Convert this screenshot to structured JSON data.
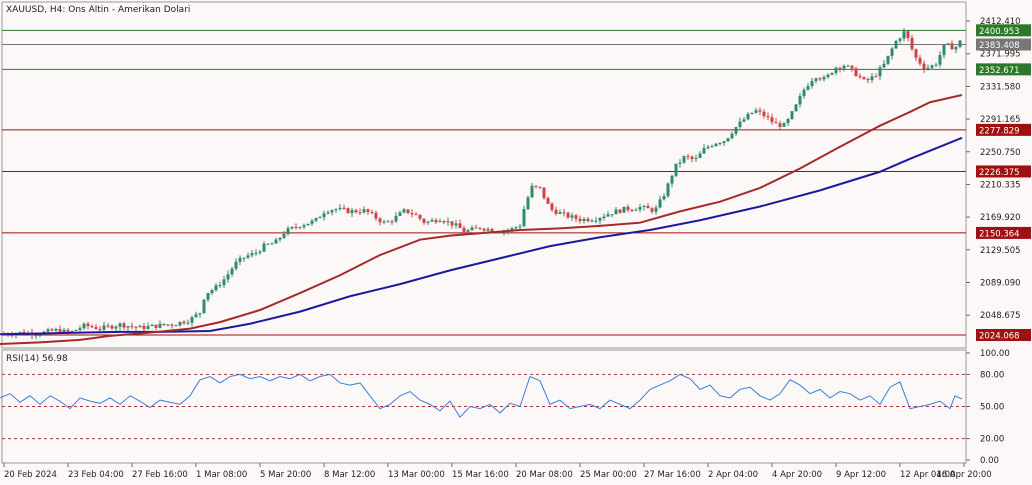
{
  "window": {
    "symbol_title": "XAUUSD, H4:  Ons Altin - Amerikan Dolari"
  },
  "colors": {
    "background": "#fdf8f8",
    "candle_up": "#2e8b6e",
    "candle_down": "#cc4444",
    "ma_fast": "#a52a2a",
    "ma_slow": "#1a1aa0",
    "rsi_line": "#3a7fd4",
    "level_green": "#2a7a2a",
    "level_red": "#a01010"
  },
  "chart_data": [
    {
      "type": "candlestick",
      "title": "XAUUSD, H4:  Ons Altin - Amerikan Dolari",
      "ylim": [
        2008,
        2436
      ],
      "y_ticks": [
        "2412.410",
        "2371.995",
        "2331.580",
        "2291.165",
        "2250.750",
        "2210.335",
        "2169.920",
        "2129.505",
        "2089.090",
        "2048.675"
      ],
      "x_ticks": [
        "20 Feb 2024",
        "23 Feb 04:00",
        "27 Feb 16:00",
        "1 Mar 08:00",
        "5 Mar 20:00",
        "8 Mar 12:00",
        "13 Mar 00:00",
        "15 Mar 16:00",
        "20 Mar 08:00",
        "25 Mar 00:00",
        "27 Mar 16:00",
        "2 Apr 04:00",
        "4 Apr 20:00",
        "9 Apr 12:00",
        "12 Apr 04:00",
        "16 Apr 20:00"
      ],
      "price_levels": [
        {
          "value": 2400.953,
          "label": "2400.953",
          "color": "green"
        },
        {
          "value": 2383.408,
          "label": "2383.408",
          "color": "gray"
        },
        {
          "value": 2352.671,
          "label": "2352.671",
          "color": "green"
        },
        {
          "value": 2277.829,
          "label": "2277.829",
          "color": "red"
        },
        {
          "value": 2226.375,
          "label": "2226.375",
          "color": "red"
        },
        {
          "value": 2150.364,
          "label": "2150.364",
          "color": "red"
        },
        {
          "value": 2024.068,
          "label": "2024.068",
          "color": "red"
        }
      ],
      "price_path": [
        [
          0,
          2025
        ],
        [
          20,
          2027
        ],
        [
          40,
          2026
        ],
        [
          55,
          2030
        ],
        [
          70,
          2027
        ],
        [
          85,
          2036
        ],
        [
          100,
          2032
        ],
        [
          120,
          2037
        ],
        [
          140,
          2033
        ],
        [
          160,
          2036
        ],
        [
          175,
          2038
        ],
        [
          190,
          2043
        ],
        [
          200,
          2052
        ],
        [
          205,
          2075
        ],
        [
          215,
          2082
        ],
        [
          225,
          2094
        ],
        [
          235,
          2112
        ],
        [
          245,
          2121
        ],
        [
          255,
          2125
        ],
        [
          265,
          2135
        ],
        [
          275,
          2138
        ],
        [
          285,
          2152
        ],
        [
          300,
          2160
        ],
        [
          315,
          2165
        ],
        [
          325,
          2178
        ],
        [
          335,
          2180
        ],
        [
          350,
          2177
        ],
        [
          365,
          2178
        ],
        [
          375,
          2170
        ],
        [
          385,
          2162
        ],
        [
          395,
          2169
        ],
        [
          405,
          2178
        ],
        [
          415,
          2173
        ],
        [
          425,
          2163
        ],
        [
          440,
          2168
        ],
        [
          455,
          2160
        ],
        [
          465,
          2152
        ],
        [
          480,
          2157
        ],
        [
          495,
          2153
        ],
        [
          510,
          2154
        ],
        [
          520,
          2160
        ],
        [
          525,
          2185
        ],
        [
          532,
          2207
        ],
        [
          540,
          2205
        ],
        [
          550,
          2180
        ],
        [
          565,
          2172
        ],
        [
          580,
          2167
        ],
        [
          595,
          2168
        ],
        [
          610,
          2175
        ],
        [
          625,
          2180
        ],
        [
          640,
          2182
        ],
        [
          655,
          2178
        ],
        [
          665,
          2200
        ],
        [
          675,
          2232
        ],
        [
          685,
          2245
        ],
        [
          695,
          2240
        ],
        [
          705,
          2255
        ],
        [
          715,
          2262
        ],
        [
          725,
          2265
        ],
        [
          735,
          2280
        ],
        [
          745,
          2292
        ],
        [
          755,
          2302
        ],
        [
          765,
          2295
        ],
        [
          775,
          2285
        ],
        [
          785,
          2283
        ],
        [
          795,
          2305
        ],
        [
          805,
          2330
        ],
        [
          815,
          2345
        ],
        [
          825,
          2340
        ],
        [
          835,
          2355
        ],
        [
          845,
          2358
        ],
        [
          855,
          2348
        ],
        [
          865,
          2337
        ],
        [
          875,
          2345
        ],
        [
          885,
          2360
        ],
        [
          895,
          2386
        ],
        [
          905,
          2400
        ],
        [
          915,
          2368
        ],
        [
          925,
          2354
        ],
        [
          935,
          2358
        ],
        [
          945,
          2383
        ],
        [
          955,
          2379
        ],
        [
          962,
          2390
        ]
      ],
      "ma_fast_path": [
        [
          0,
          2013
        ],
        [
          40,
          2015
        ],
        [
          80,
          2018
        ],
        [
          110,
          2023
        ],
        [
          150,
          2027
        ],
        [
          190,
          2032
        ],
        [
          220,
          2040
        ],
        [
          260,
          2055
        ],
        [
          300,
          2076
        ],
        [
          340,
          2098
        ],
        [
          380,
          2123
        ],
        [
          420,
          2142
        ],
        [
          450,
          2147
        ],
        [
          480,
          2150
        ],
        [
          520,
          2154
        ],
        [
          560,
          2156
        ],
        [
          600,
          2159
        ],
        [
          640,
          2163
        ],
        [
          680,
          2177
        ],
        [
          720,
          2189
        ],
        [
          760,
          2206
        ],
        [
          800,
          2230
        ],
        [
          840,
          2257
        ],
        [
          880,
          2283
        ],
        [
          910,
          2300
        ],
        [
          930,
          2312
        ],
        [
          962,
          2321
        ]
      ],
      "ma_slow_path": [
        [
          0,
          2025
        ],
        [
          40,
          2026
        ],
        [
          80,
          2027
        ],
        [
          120,
          2028
        ],
        [
          160,
          2028
        ],
        [
          210,
          2029
        ],
        [
          250,
          2038
        ],
        [
          300,
          2053
        ],
        [
          350,
          2072
        ],
        [
          400,
          2087
        ],
        [
          450,
          2104
        ],
        [
          500,
          2119
        ],
        [
          550,
          2134
        ],
        [
          600,
          2145
        ],
        [
          650,
          2154
        ],
        [
          700,
          2166
        ],
        [
          760,
          2183
        ],
        [
          820,
          2203
        ],
        [
          880,
          2226
        ],
        [
          910,
          2242
        ],
        [
          962,
          2268
        ]
      ]
    },
    {
      "type": "line",
      "title": "RSI(14) 56.98",
      "ylim": [
        0,
        100
      ],
      "y_ticks": [
        "100.00",
        "80.00",
        "50.00",
        "20.00",
        "0.00"
      ],
      "levels": [
        80,
        50,
        20
      ],
      "values": [
        [
          0,
          58
        ],
        [
          10,
          62
        ],
        [
          20,
          54
        ],
        [
          30,
          60
        ],
        [
          40,
          52
        ],
        [
          50,
          60
        ],
        [
          60,
          55
        ],
        [
          70,
          48
        ],
        [
          80,
          58
        ],
        [
          90,
          55
        ],
        [
          100,
          53
        ],
        [
          110,
          58
        ],
        [
          120,
          52
        ],
        [
          130,
          60
        ],
        [
          140,
          55
        ],
        [
          150,
          49
        ],
        [
          160,
          56
        ],
        [
          170,
          54
        ],
        [
          180,
          52
        ],
        [
          190,
          60
        ],
        [
          200,
          75
        ],
        [
          210,
          78
        ],
        [
          220,
          72
        ],
        [
          230,
          78
        ],
        [
          240,
          80
        ],
        [
          250,
          76
        ],
        [
          260,
          78
        ],
        [
          270,
          74
        ],
        [
          280,
          78
        ],
        [
          290,
          76
        ],
        [
          300,
          80
        ],
        [
          310,
          74
        ],
        [
          320,
          78
        ],
        [
          330,
          80
        ],
        [
          340,
          72
        ],
        [
          350,
          70
        ],
        [
          360,
          72
        ],
        [
          370,
          60
        ],
        [
          380,
          48
        ],
        [
          390,
          52
        ],
        [
          400,
          60
        ],
        [
          410,
          64
        ],
        [
          420,
          56
        ],
        [
          430,
          52
        ],
        [
          440,
          46
        ],
        [
          450,
          55
        ],
        [
          460,
          40
        ],
        [
          470,
          50
        ],
        [
          480,
          48
        ],
        [
          490,
          52
        ],
        [
          500,
          44
        ],
        [
          510,
          53
        ],
        [
          520,
          50
        ],
        [
          530,
          78
        ],
        [
          540,
          74
        ],
        [
          550,
          52
        ],
        [
          560,
          56
        ],
        [
          570,
          48
        ],
        [
          580,
          50
        ],
        [
          590,
          52
        ],
        [
          600,
          48
        ],
        [
          610,
          56
        ],
        [
          620,
          52
        ],
        [
          630,
          48
        ],
        [
          640,
          56
        ],
        [
          650,
          66
        ],
        [
          660,
          70
        ],
        [
          670,
          74
        ],
        [
          680,
          80
        ],
        [
          690,
          76
        ],
        [
          700,
          66
        ],
        [
          710,
          70
        ],
        [
          720,
          60
        ],
        [
          730,
          58
        ],
        [
          740,
          66
        ],
        [
          750,
          68
        ],
        [
          760,
          60
        ],
        [
          770,
          56
        ],
        [
          780,
          62
        ],
        [
          790,
          75
        ],
        [
          800,
          70
        ],
        [
          810,
          62
        ],
        [
          820,
          66
        ],
        [
          830,
          58
        ],
        [
          840,
          64
        ],
        [
          850,
          62
        ],
        [
          860,
          56
        ],
        [
          870,
          60
        ],
        [
          880,
          52
        ],
        [
          890,
          68
        ],
        [
          900,
          73
        ],
        [
          910,
          48
        ],
        [
          920,
          50
        ],
        [
          930,
          52
        ],
        [
          940,
          55
        ],
        [
          950,
          48
        ],
        [
          955,
          60
        ],
        [
          962,
          57
        ]
      ]
    }
  ]
}
